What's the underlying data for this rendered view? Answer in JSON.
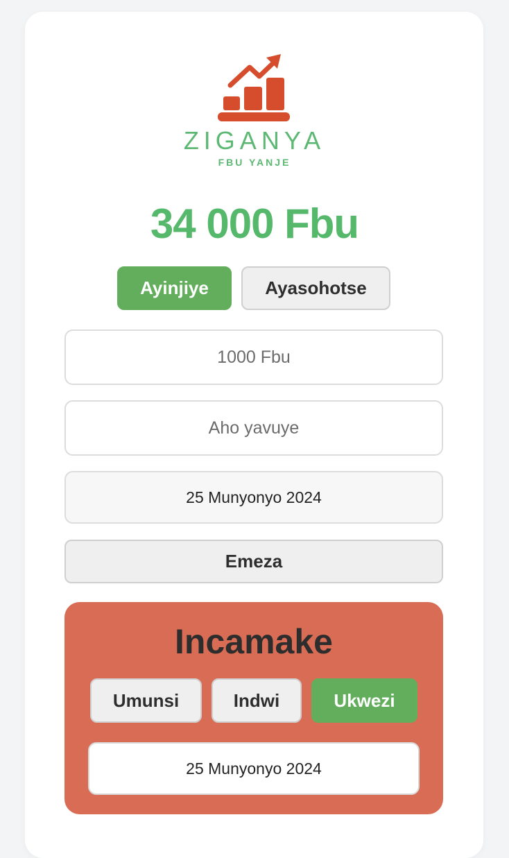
{
  "logo": {
    "name": "ZIGANYA",
    "tagline": "FBU YANJE",
    "colors": {
      "chart": "#d54d2c",
      "text": "#5cb873"
    }
  },
  "balance": "34 000 Fbu",
  "type_tabs": {
    "income": "Ayinjiye",
    "expense": "Ayasohotse",
    "active": "income"
  },
  "form": {
    "amount_placeholder": "1000 Fbu",
    "source_placeholder": "Aho yavuye",
    "date_value": "25 Munyonyo 2024",
    "submit_label": "Emeza"
  },
  "summary": {
    "title": "Incamake",
    "period_tabs": {
      "day": "Umunsi",
      "week": "Indwi",
      "month": "Ukwezi",
      "active": "month"
    },
    "date_value": "25 Munyonyo 2024",
    "background": "#d96c54"
  },
  "colors": {
    "accent": "#62ae5c",
    "balance": "#55b86b"
  }
}
